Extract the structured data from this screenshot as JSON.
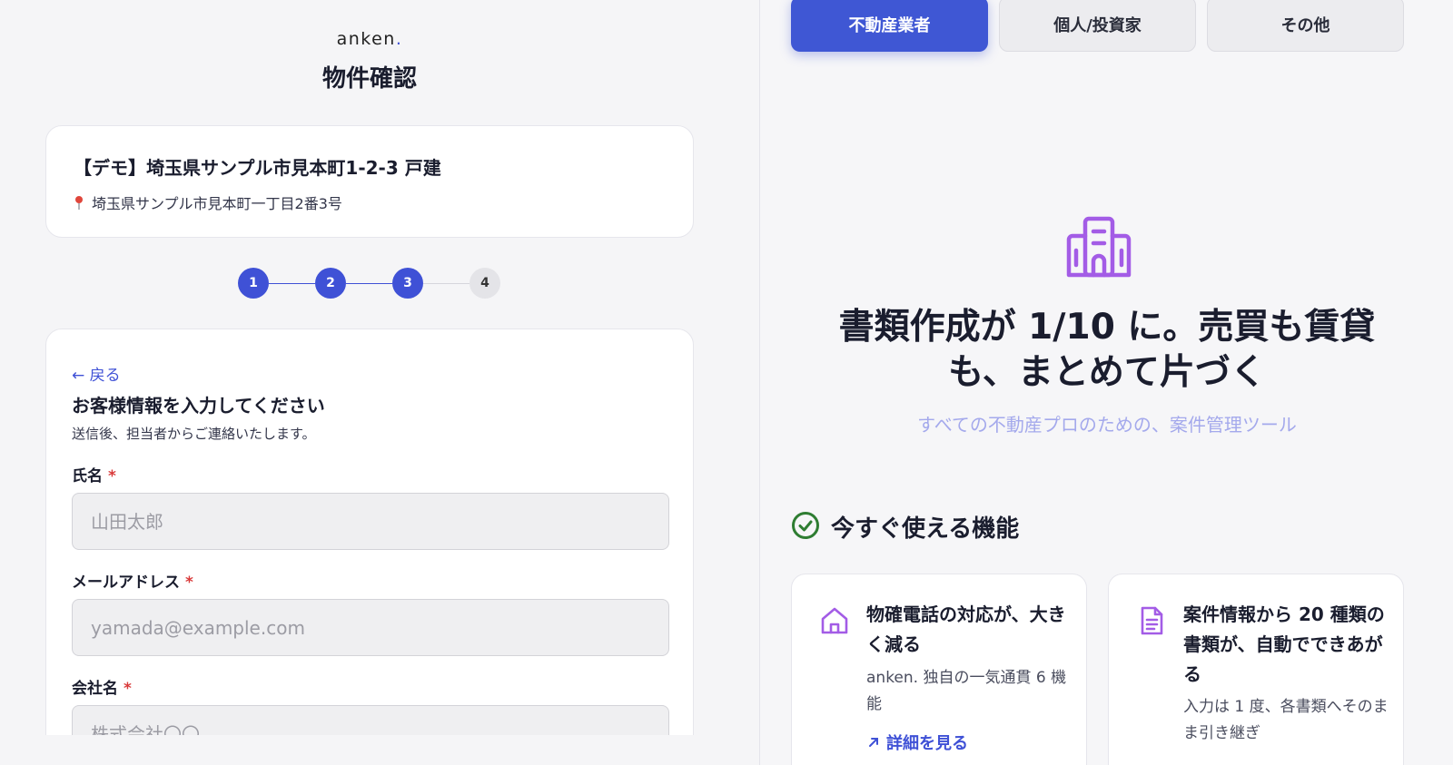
{
  "left": {
    "brand": "anken",
    "brand_dot": ".",
    "page_title": "物件確認",
    "property": {
      "title": "【デモ】埼玉県サンプル市見本町1-2-3 戸建",
      "address": "埼玉県サンプル市見本町一丁目2番3号"
    },
    "stepper": {
      "steps": [
        "1",
        "2",
        "3",
        "4"
      ],
      "current": 3
    },
    "form": {
      "back_label": "← 戻る",
      "heading": "お客様情報を入力してください",
      "subtext": "送信後、担当者からご連絡いたします。",
      "required_mark": "*",
      "fields": [
        {
          "label": "氏名",
          "placeholder": "山田太郎"
        },
        {
          "label": "メールアドレス",
          "placeholder": "yamada@example.com"
        },
        {
          "label": "会社名",
          "placeholder": "株式会社〇〇"
        }
      ]
    }
  },
  "right": {
    "tabs": [
      {
        "label": "不動産業者",
        "active": true
      },
      {
        "label": "個人/投資家",
        "active": false
      },
      {
        "label": "その他",
        "active": false
      }
    ],
    "hero": {
      "icon": "building-icon",
      "title": "書類作成が 1/10 に。売買も賃貸も、まとめて片づく",
      "subtitle": "すべての不動産プロのための、案件管理ツール"
    },
    "features": {
      "icon": "check-circle-icon",
      "title": "今すぐ使える機能",
      "cards": [
        {
          "icon": "home-icon",
          "title": "物確電話の対応が、大きく減る",
          "desc": "anken. 独自の一気通貫 6 機能",
          "link": "詳細を見る"
        },
        {
          "icon": "document-icon",
          "title": "案件情報から 20 種類の書類が、自動でできあがる",
          "desc": "入力は 1 度、各書類へそのまま引き継ぎ"
        }
      ]
    },
    "colors": {
      "accent": "#3f51d6",
      "icon_purple": "#a35ce6",
      "check_green": "#2e7d32",
      "required_red": "#d93a3a"
    }
  }
}
